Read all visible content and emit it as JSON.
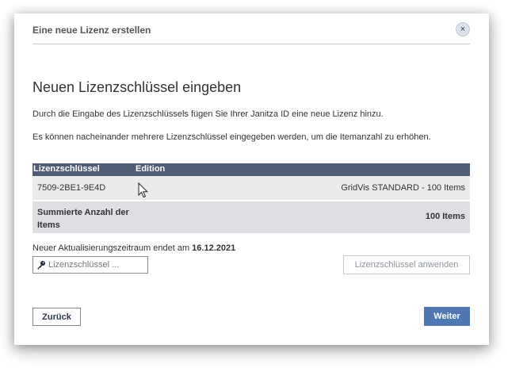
{
  "dialog": {
    "header_title": "Eine neue Lizenz erstellen",
    "close_glyph": "×",
    "title": "Neuen Lizenzschlüssel eingeben",
    "description_1": "Durch die Eingabe des Lizenzschlüssels fügen Sie Ihrer Janitza ID eine neue Lizenz hinzu.",
    "description_2": "Es können nacheinander mehrere Lizenzschlüssel eingegeben werden, um die Itemanzahl zu erhöhen."
  },
  "table": {
    "headers": [
      "Lizenzschlüssel",
      "Edition"
    ],
    "rows": [
      {
        "key": "7509-2BE1-9E4D",
        "edition": "GridVis STANDARD - 100 Items"
      }
    ],
    "summary_label": "Summierte Anzahl der Items",
    "summary_value": "100 Items"
  },
  "period": {
    "text": "Neuer Aktualisierungszeitraum endet am",
    "date": "16.12.2021"
  },
  "input": {
    "placeholder": "Lizenzschlüssel ...",
    "value": "",
    "icon": "key-icon"
  },
  "buttons": {
    "apply": "Lizenzschlüssel anwenden",
    "back": "Zurück",
    "next": "Weiter"
  },
  "colors": {
    "table_header": "#4f5d74",
    "primary_button": "#4f77b2",
    "row_bg": "#ebebeb",
    "summary_bg": "#dedfe3"
  }
}
